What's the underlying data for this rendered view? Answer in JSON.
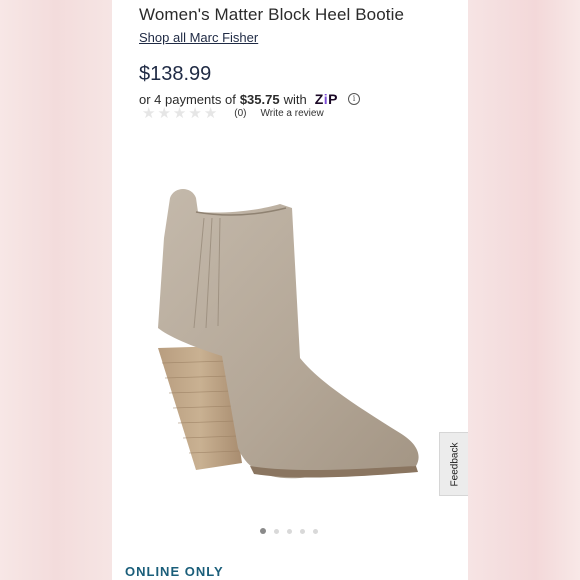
{
  "product": {
    "title": "Women's Matter Block Heel Bootie",
    "brand_link": "Shop all Marc Fisher",
    "price": "$138.99"
  },
  "payment": {
    "prefix": "or 4 payments of",
    "amount": "$35.75",
    "suffix": "with",
    "provider_logo_text": "zip",
    "info_icon": "info-icon"
  },
  "rating": {
    "stars_filled": 0,
    "stars_total": 5,
    "count": "(0)",
    "write_review": "Write a review"
  },
  "gallery": {
    "image_subject": "taupe suede block heel ankle bootie",
    "slide_count": 5,
    "active_slide": 1
  },
  "feedback_tab": {
    "label": "Feedback"
  },
  "badge": {
    "online_only": "ONLINE ONLY"
  },
  "colors": {
    "price": "#1f2a44",
    "online_only": "#1a5e7a",
    "zip_accent": "#7b4bd6",
    "boot": "#b5a898"
  }
}
